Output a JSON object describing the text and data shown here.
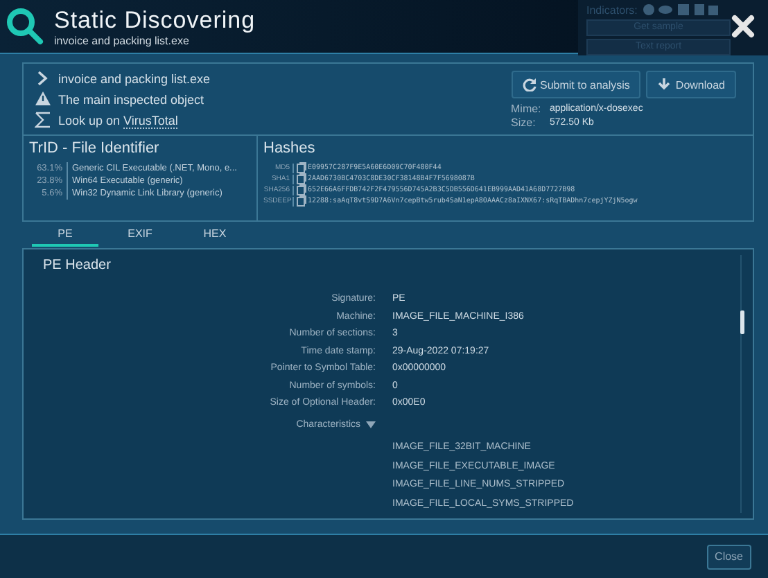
{
  "header": {
    "title": "Static Discovering",
    "subtitle": "invoice and packing list.exe"
  },
  "background_panel": {
    "indicators_label": "Indicators:",
    "buttons": [
      "Get sample",
      "Text report"
    ]
  },
  "object_info": {
    "items": [
      {
        "kind": "file",
        "text": "invoice and packing list.exe"
      },
      {
        "kind": "warning",
        "text": "The main inspected object"
      },
      {
        "kind": "lookup",
        "text": "Look up on ",
        "link": "VirusTotal"
      }
    ],
    "actions": [
      {
        "kind": "refresh",
        "label": "Submit to analysis"
      },
      {
        "kind": "download",
        "label": "Download"
      }
    ],
    "meta": [
      {
        "label": "Mime:",
        "value": "application/x-dosexec"
      },
      {
        "label": "Size:",
        "value": "572.50 Kb"
      }
    ]
  },
  "trid": {
    "title": "TrID - File Identifier",
    "rows": [
      {
        "percent": "63.1%",
        "description": "Generic CIL Executable (.NET, Mono, e..."
      },
      {
        "percent": "23.8%",
        "description": "Win64 Executable (generic)"
      },
      {
        "percent": "5.6%",
        "description": "Win32 Dynamic Link Library (generic)"
      }
    ]
  },
  "hashes": {
    "title": "Hashes",
    "rows": [
      {
        "name": "MD5",
        "value": "E09957C287F9E5A60E6D09C70F480F44"
      },
      {
        "name": "SHA1",
        "value": "2AAD6730BC4703C8DE30CF38148B4F7F5698087B"
      },
      {
        "name": "SHA256",
        "value": "652E66A6FFDB742F2F479556D745A2B3C5DB556D641EB999AAD41A68D7727B98"
      },
      {
        "name": "SSDEEP",
        "value": "12288:saAqT8vtS9D7A6Vn7cepBtw5rub4SaN1epA80AAACz8aIXNX67:sRqTBADhn7cepjYZjN5ogw"
      }
    ]
  },
  "tabs": [
    {
      "label": "PE",
      "selected": true
    },
    {
      "label": "EXIF",
      "selected": false
    },
    {
      "label": "HEX",
      "selected": false
    }
  ],
  "pe_header": {
    "title": "PE Header",
    "fields": [
      {
        "label": "Signature:",
        "value": "PE"
      },
      {
        "label": "Machine:",
        "value": "IMAGE_FILE_MACHINE_I386"
      },
      {
        "label": "Number of sections:",
        "value": "3"
      },
      {
        "label": "Time date stamp:",
        "value": "29-Aug-2022 07:19:27"
      },
      {
        "label": "Pointer to Symbol Table:",
        "value": "0x00000000"
      },
      {
        "label": "Number of symbols:",
        "value": "0"
      },
      {
        "label": "Size of Optional Header:",
        "value": "0x00E0"
      }
    ],
    "characteristics": {
      "label": "Characteristics",
      "expanded": true,
      "flags": [
        "IMAGE_FILE_32BIT_MACHINE",
        "IMAGE_FILE_EXECUTABLE_IMAGE",
        "IMAGE_FILE_LINE_NUMS_STRIPPED",
        "IMAGE_FILE_LOCAL_SYMS_STRIPPED"
      ]
    }
  },
  "footer": {
    "close_button": "Close"
  }
}
